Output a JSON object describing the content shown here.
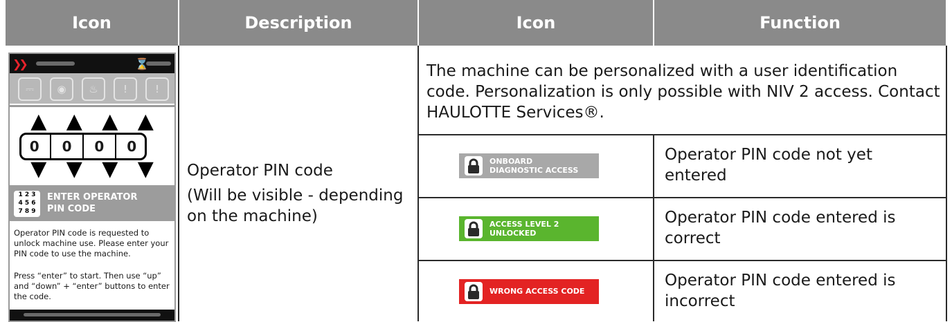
{
  "headers": {
    "col1": "Icon",
    "col2": "Description",
    "col3": "Icon",
    "col4": "Function"
  },
  "screen": {
    "pin_digits": [
      "0",
      "0",
      "0",
      "0"
    ],
    "prompt_line1": "ENTER OPERATOR",
    "prompt_line2": "PIN CODE",
    "keypad_row1": "1 2 3",
    "keypad_row2": "4 5 6",
    "keypad_row3": "7 8 9",
    "instruction1": "Operator PIN code is requested to unlock machine use. Please enter your PIN code to use the machine.",
    "instruction2": "Press “enter” to start. Then use “up” and “down” + “enter” buttons to enter the code."
  },
  "description": {
    "title": "Operator PIN code",
    "note": "(Will be visible - depending on the machine)"
  },
  "intro": "The machine can be personalized with a user identification code. Personalization is only possible with NIV 2 access. Contact HAULOTTE Services®.",
  "states": [
    {
      "badge_line1": "ONBOARD",
      "badge_line2": "DIAGNOSTIC ACCESS",
      "badge_color": "#a8a8a8",
      "function": "Operator PIN code not yet entered"
    },
    {
      "badge_line1": "ACCESS LEVEL 2",
      "badge_line2": "UNLOCKED",
      "badge_color": "#5ab52e",
      "function": "Operator PIN code entered is correct"
    },
    {
      "badge_line1": "WRONG ACCESS CODE",
      "badge_line2": "",
      "badge_color": "#e32323",
      "function": "Operator PIN code entered is incorrect"
    }
  ]
}
